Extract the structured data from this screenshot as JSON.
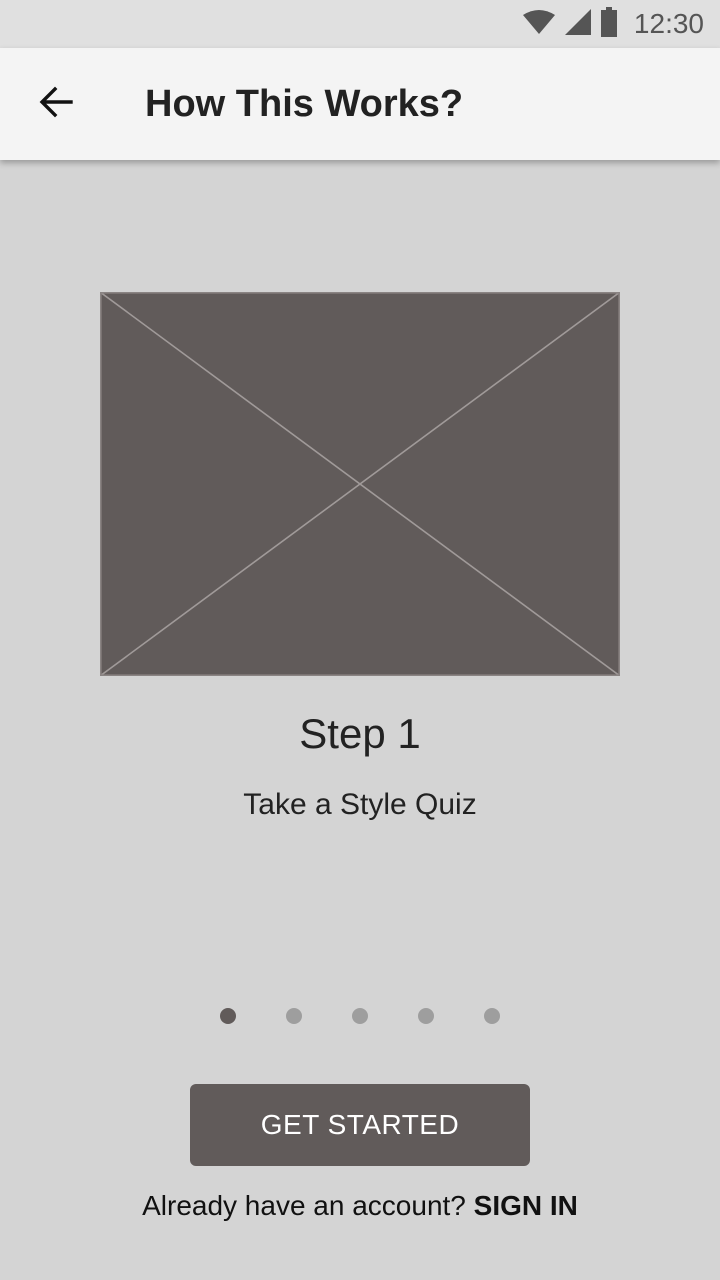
{
  "status_bar": {
    "time": "12:30",
    "icons": [
      "wifi-icon",
      "signal-icon",
      "battery-icon"
    ]
  },
  "app_bar": {
    "back_icon": "arrow-left-icon",
    "title": "How This Works?"
  },
  "onboarding": {
    "image": "image-placeholder",
    "step_title": "Step 1",
    "step_description": "Take a Style Quiz",
    "page_indicator": {
      "total": 5,
      "active_index": 0
    }
  },
  "actions": {
    "get_started_label": "GET STARTED",
    "signin_prompt": "Already have an account?",
    "signin_label": "SIGN IN"
  },
  "colors": {
    "background": "#d4d4d4",
    "app_bar": "#f4f4f4",
    "status_bar": "#e0e0e0",
    "accent": "#615b5a",
    "inactive_dot": "#9e9e9e"
  }
}
